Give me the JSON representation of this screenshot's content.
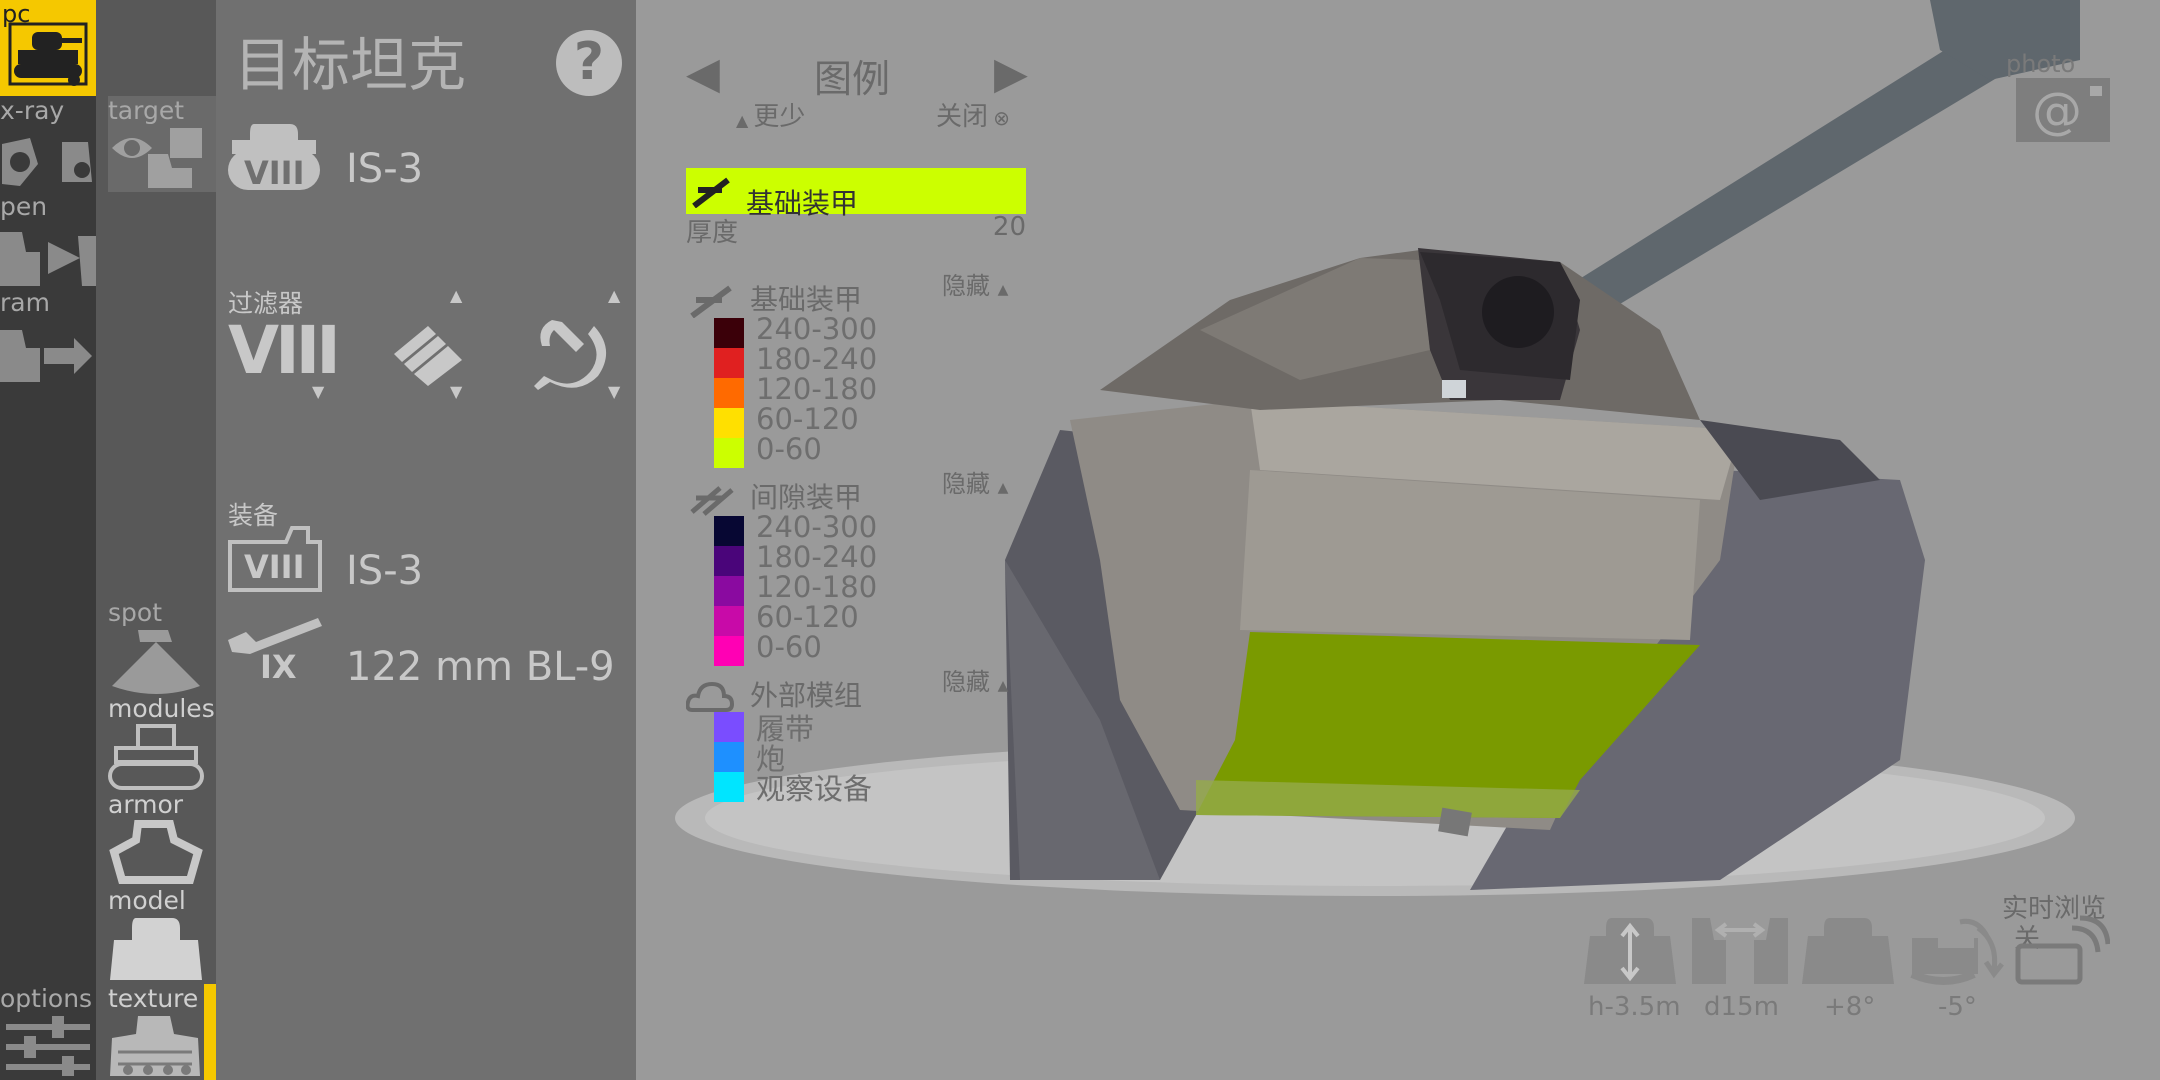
{
  "colors": {
    "accent": "#f5c800",
    "highlight": "#ccff00",
    "armor_240_300": "#3b0009",
    "armor_180_240": "#e02020",
    "armor_120_180": "#ff6a00",
    "armor_60_120": "#ffe000",
    "armor_0_60": "#ccff00",
    "spaced_240_300": "#070733",
    "spaced_180_240": "#4a057a",
    "spaced_120_180": "#8a0aa0",
    "spaced_60_120": "#c80aa8",
    "spaced_0_60": "#ff00b4",
    "module_tracks": "#7a4dff",
    "module_gun": "#1e90ff",
    "module_optics": "#00e5ff"
  },
  "nav": {
    "pc": "pc",
    "xray": "x-ray",
    "pen": "pen",
    "ram": "ram",
    "options": "options",
    "target": "target",
    "spot": "spot",
    "modules": "modules",
    "armor": "armor",
    "model": "model",
    "texture": "texture"
  },
  "panel": {
    "title": "目标坦克",
    "help": "?",
    "target_tier": "VIII",
    "target_name": "IS-3",
    "filter_label": "过滤器",
    "filter_tier": "VIII",
    "equipment_label": "装备",
    "equip_tier": "VIII",
    "equip_name": "IS-3",
    "gun_tier": "IX",
    "gun_name": "122 mm BL-9"
  },
  "legend": {
    "title": "图例",
    "less": "更少",
    "close": "关闭",
    "selected_label": "基础装甲",
    "thickness_label": "厚度",
    "thickness_value": "20",
    "hide": "隐藏",
    "base_title": "基础装甲",
    "base_ranges": [
      "240-300",
      "180-240",
      "120-180",
      "60-120",
      "0-60"
    ],
    "spaced_title": "间隙装甲",
    "spaced_ranges": [
      "240-300",
      "180-240",
      "120-180",
      "60-120",
      "0-60"
    ],
    "modules_title": "外部模组",
    "modules": [
      "履带",
      "炮",
      "观察设备"
    ]
  },
  "viewport": {
    "photo": "photo",
    "live_view": "实时浏览",
    "live_state": "关",
    "height": "h-3.5m",
    "distance": "d15m",
    "pitch_up": "+8°",
    "pitch_down": "-5°"
  }
}
